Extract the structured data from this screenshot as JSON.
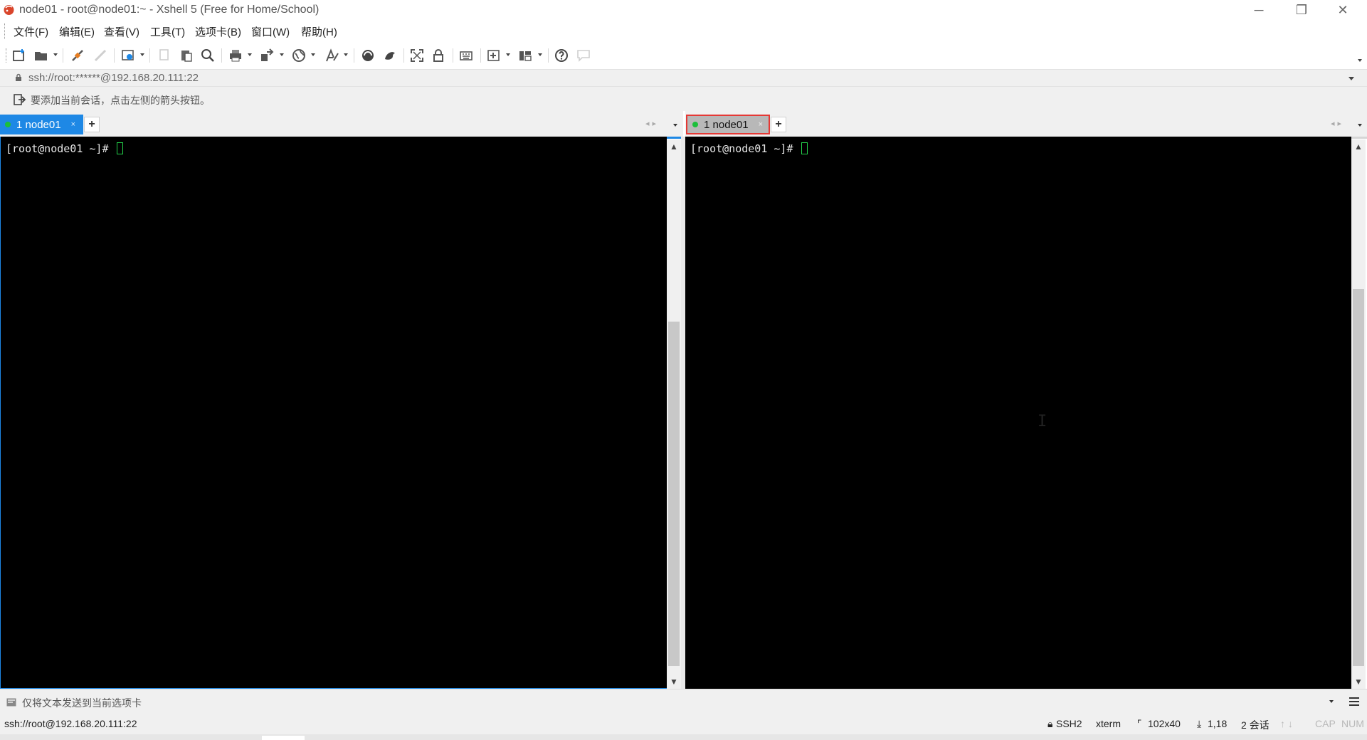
{
  "window": {
    "title": "node01 - root@node01:~ - Xshell 5 (Free for Home/School)",
    "controls": {
      "minimize": "─",
      "restore": "❐",
      "close": "✕"
    }
  },
  "menu": {
    "items": [
      "文件(F)",
      "编辑(E)",
      "查看(V)",
      "工具(T)",
      "选项卡(B)",
      "窗口(W)",
      "帮助(H)"
    ]
  },
  "toolbar": {
    "icons": [
      "new-session-icon",
      "open-folder-icon",
      "connect-icon",
      "disconnect-icon",
      "properties-icon",
      "copy-icon",
      "paste-icon",
      "find-icon",
      "print-icon",
      "transfer-icon",
      "globe-icon",
      "font-icon",
      "xftp-icon",
      "xmanager-icon",
      "fullscreen-icon",
      "lock-icon",
      "keyboard-icon",
      "new-tab-icon",
      "layout-icon",
      "help-icon",
      "chat-icon"
    ]
  },
  "address": {
    "value": "ssh://root:******@192.168.20.111:22"
  },
  "hint": {
    "text": "要添加当前会话，点击左侧的箭头按钮。"
  },
  "panes": {
    "left": {
      "tab_label": "1 node01",
      "tab_close": "×",
      "add_tab": "+",
      "prompt": "[root@node01 ~]# "
    },
    "right": {
      "tab_label": "1 node01",
      "tab_close": "×",
      "add_tab": "+",
      "prompt": "[root@node01 ~]# "
    }
  },
  "sendbar": {
    "text": "仅将文本发送到当前选项卡"
  },
  "status": {
    "address": "ssh://root@192.168.20.111:22",
    "protocol": "SSH2",
    "terminal": "xterm",
    "size": "102x40",
    "position": "1,18",
    "sessions": "2 会话",
    "arrows": "↑ ↓",
    "cap": "CAP",
    "num": "NUM"
  },
  "colors": {
    "tab_active": "#1e88e5",
    "tab_highlight_border": "#e53935",
    "cursor": "#23d14a",
    "session_dot": "#1bbf3a"
  }
}
